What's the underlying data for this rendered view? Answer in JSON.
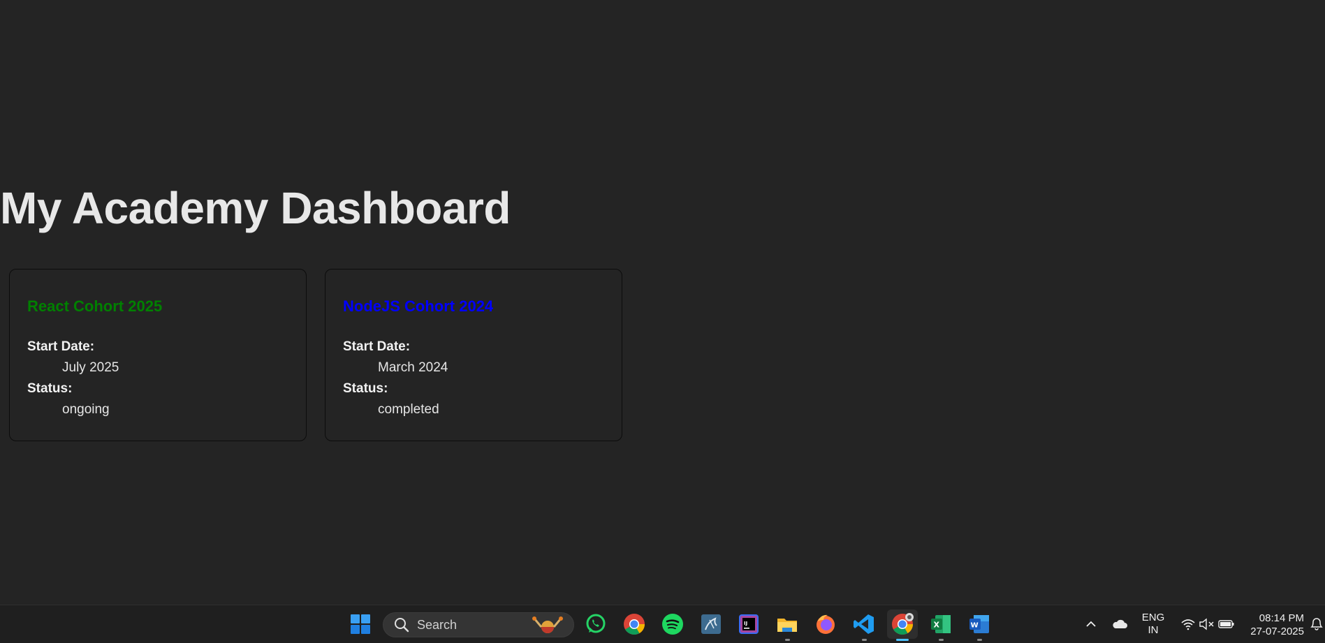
{
  "page": {
    "title": "My Academy Dashboard"
  },
  "cards": [
    {
      "title": "React Cohort 2025",
      "title_color": "#008000",
      "start_label": "Start Date:",
      "start_value": "July 2025",
      "status_label": "Status:",
      "status_value": "ongoing"
    },
    {
      "title": "NodeJS Cohort 2024",
      "title_color": "#0000ff",
      "start_label": "Start Date:",
      "start_value": "March 2024",
      "status_label": "Status:",
      "status_value": "completed"
    }
  ],
  "taskbar": {
    "search_label": "Search",
    "apps": [
      "start-icon",
      "whatsapp-icon",
      "chrome-icon",
      "spotify-icon",
      "mysql-workbench-icon",
      "intellij-icon",
      "file-explorer-icon",
      "firefox-icon",
      "vscode-icon",
      "chrome-active-icon",
      "excel-icon",
      "word-icon"
    ],
    "language_line1": "ENG",
    "language_line2": "IN",
    "time": "08:14 PM",
    "date": "27-07-2025"
  }
}
